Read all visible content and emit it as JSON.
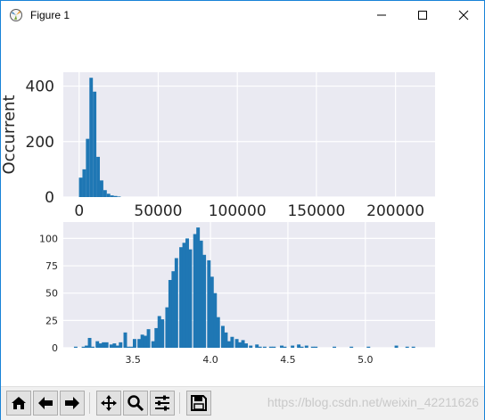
{
  "window": {
    "title": "Figure 1"
  },
  "icons": {
    "app": "matplotlib-icon",
    "minimize": "minimize-icon",
    "maximize": "maximize-icon",
    "close": "close-icon"
  },
  "toolbar": {
    "buttons": [
      "home-icon",
      "back-icon",
      "forward-icon",
      "pan-icon",
      "zoom-icon",
      "configure-subplots-icon",
      "save-icon"
    ]
  },
  "watermark": "https://blog.csdn.net/weixin_42211626",
  "colors": {
    "bar": "#1f77b4",
    "axes_bg": "#eaeaf2",
    "grid": "#ffffff",
    "window_border": "#1883d7"
  },
  "chart_data": [
    {
      "type": "bar",
      "title": "",
      "xlabel": "",
      "ylabel": "Occurrent",
      "xlim": [
        -10000,
        225000
      ],
      "ylim": [
        0,
        450
      ],
      "xticks": [
        "0",
        "50000",
        "100000",
        "150000",
        "200000"
      ],
      "yticks": [
        "0",
        "200",
        "400"
      ],
      "grid": true,
      "bin_width": 2200,
      "x": [
        1000,
        3200,
        5400,
        7600,
        9800,
        12000,
        14200,
        16400,
        18600,
        20800,
        23000,
        25200
      ],
      "values": [
        70,
        100,
        210,
        430,
        380,
        145,
        60,
        25,
        12,
        6,
        4,
        2
      ]
    },
    {
      "type": "bar",
      "title": "",
      "xlabel": "",
      "ylabel": "",
      "xlim": [
        3.05,
        5.45
      ],
      "ylim": [
        0,
        115
      ],
      "xticks": [
        "3.5",
        "4.0",
        "4.5",
        "5.0"
      ],
      "yticks": [
        "0",
        "25",
        "50",
        "75",
        "100"
      ],
      "grid": true,
      "bin_width": 0.0226,
      "x": [
        3.11,
        3.13,
        3.15,
        3.18,
        3.2,
        3.22,
        3.24,
        3.27,
        3.29,
        3.31,
        3.33,
        3.36,
        3.38,
        3.4,
        3.42,
        3.45,
        3.47,
        3.49,
        3.51,
        3.54,
        3.56,
        3.58,
        3.6,
        3.63,
        3.65,
        3.67,
        3.69,
        3.72,
        3.74,
        3.76,
        3.78,
        3.81,
        3.83,
        3.85,
        3.87,
        3.9,
        3.92,
        3.94,
        3.96,
        3.99,
        4.01,
        4.03,
        4.05,
        4.08,
        4.1,
        4.12,
        4.14,
        4.17,
        4.19,
        4.21,
        4.23,
        4.26,
        4.28,
        4.3,
        4.32,
        4.35,
        4.37,
        4.39,
        4.41,
        4.44,
        4.46,
        4.48,
        4.5,
        4.53,
        4.55,
        4.57,
        4.59,
        4.62,
        4.64,
        4.66,
        4.68,
        4.71,
        4.73,
        4.75,
        4.77,
        4.8,
        4.82,
        4.84,
        4.86,
        4.89,
        4.91,
        4.93,
        4.95,
        4.98,
        5.0,
        5.02,
        5.04,
        5.07,
        5.09,
        5.11,
        5.13,
        5.16,
        5.18,
        5.2,
        5.22,
        5.25,
        5.27,
        5.29,
        5.31
      ],
      "values": [
        0,
        1,
        0,
        1,
        2,
        9,
        1,
        6,
        4,
        5,
        5,
        3,
        4,
        2,
        5,
        14,
        1,
        1,
        8,
        8,
        12,
        11,
        17,
        6,
        18,
        29,
        26,
        37,
        62,
        70,
        82,
        92,
        96,
        100,
        90,
        104,
        110,
        98,
        85,
        80,
        65,
        50,
        28,
        20,
        14,
        6,
        10,
        8,
        5,
        7,
        4,
        2,
        0,
        3,
        1,
        1,
        0,
        1,
        1,
        0,
        2,
        1,
        0,
        2,
        0,
        3,
        1,
        2,
        0,
        1,
        1,
        0,
        0,
        0,
        0,
        1,
        0,
        0,
        0,
        0,
        1,
        0,
        0,
        0,
        0,
        1,
        0,
        0,
        0,
        0,
        0,
        0,
        0,
        2,
        0,
        0,
        1,
        0,
        1
      ]
    }
  ]
}
